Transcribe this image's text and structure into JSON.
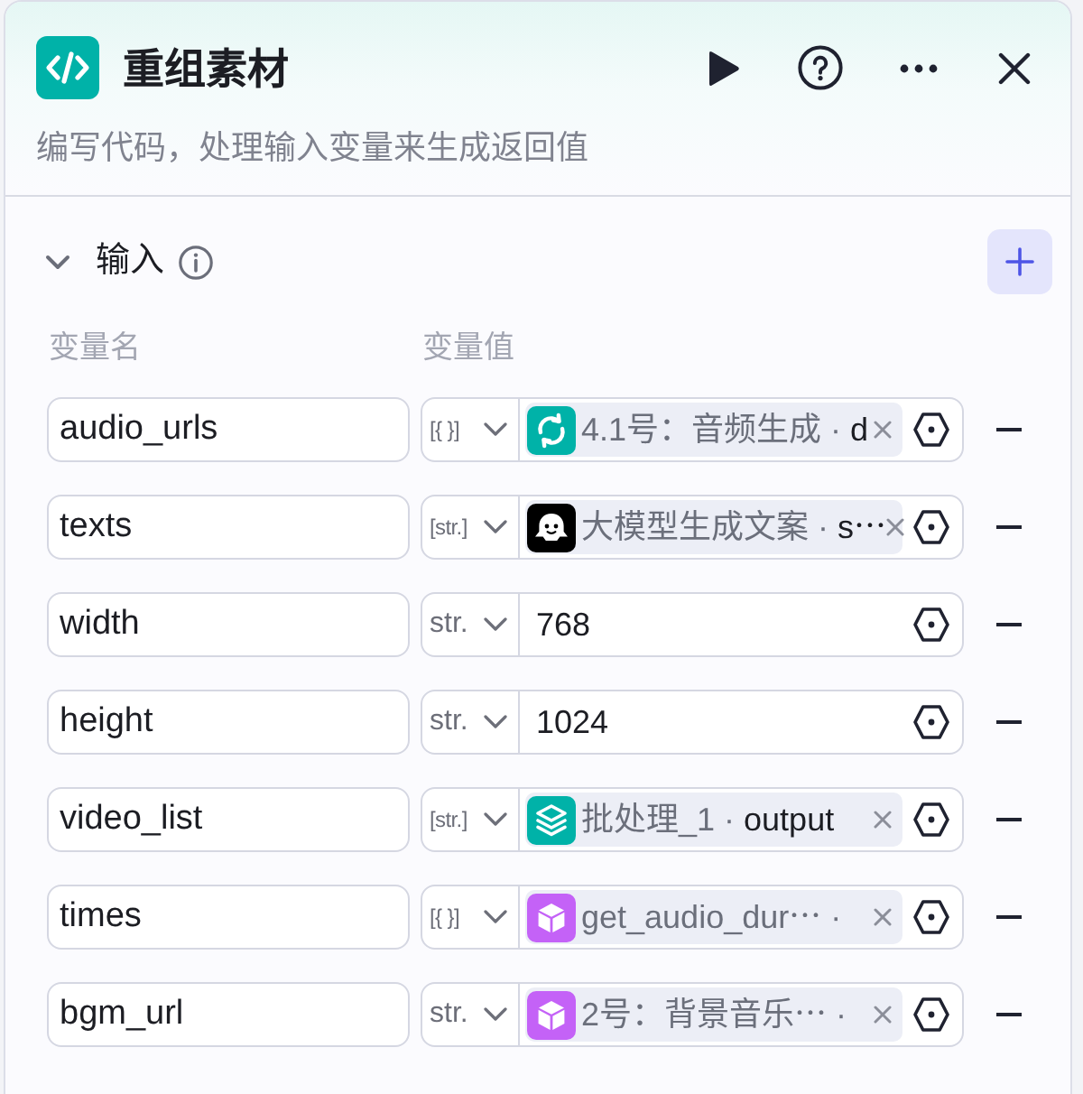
{
  "header": {
    "title": "重组素材",
    "description": "编写代码，处理输入变量来生成返回值"
  },
  "section": {
    "title": "输入",
    "expanded": true
  },
  "columns": [
    "变量名",
    "变量值"
  ],
  "variables": [
    {
      "name": "audio_urls",
      "type": {
        "label": "[{ }]",
        "kind": "array"
      },
      "value": {
        "kind": "reference",
        "node": {
          "kind": "loop",
          "color": "#00b2a8",
          "name": "4.1号：音频生成 ·"
        },
        "field": "d"
      }
    },
    {
      "name": "texts",
      "type": {
        "label": "[str.]",
        "kind": "array"
      },
      "value": {
        "kind": "reference",
        "node": {
          "kind": "llm",
          "color": "#000000",
          "name": "大模型生成文案 ·"
        },
        "field": "s⋯"
      }
    },
    {
      "name": "width",
      "type": {
        "label": "str.",
        "kind": "scalar"
      },
      "value": {
        "kind": "literal",
        "text": "768"
      }
    },
    {
      "name": "height",
      "type": {
        "label": "str.",
        "kind": "scalar"
      },
      "value": {
        "kind": "literal",
        "text": "1024"
      }
    },
    {
      "name": "video_list",
      "type": {
        "label": "[str.]",
        "kind": "array"
      },
      "value": {
        "kind": "reference",
        "node": {
          "kind": "batch",
          "color": "#00b2a8",
          "name": "批处理_1 ·"
        },
        "field": "output"
      }
    },
    {
      "name": "times",
      "type": {
        "label": "[{ }]",
        "kind": "array"
      },
      "value": {
        "kind": "reference",
        "node": {
          "kind": "plugin",
          "color": "#c462f7",
          "name": "get_audio_dur⋯ ·"
        }
      }
    },
    {
      "name": "bgm_url",
      "type": {
        "label": "str.",
        "kind": "scalar"
      },
      "value": {
        "kind": "reference",
        "node": {
          "kind": "plugin",
          "color": "#c462f7",
          "name": "2号：背景音乐⋯  ·"
        }
      }
    }
  ]
}
